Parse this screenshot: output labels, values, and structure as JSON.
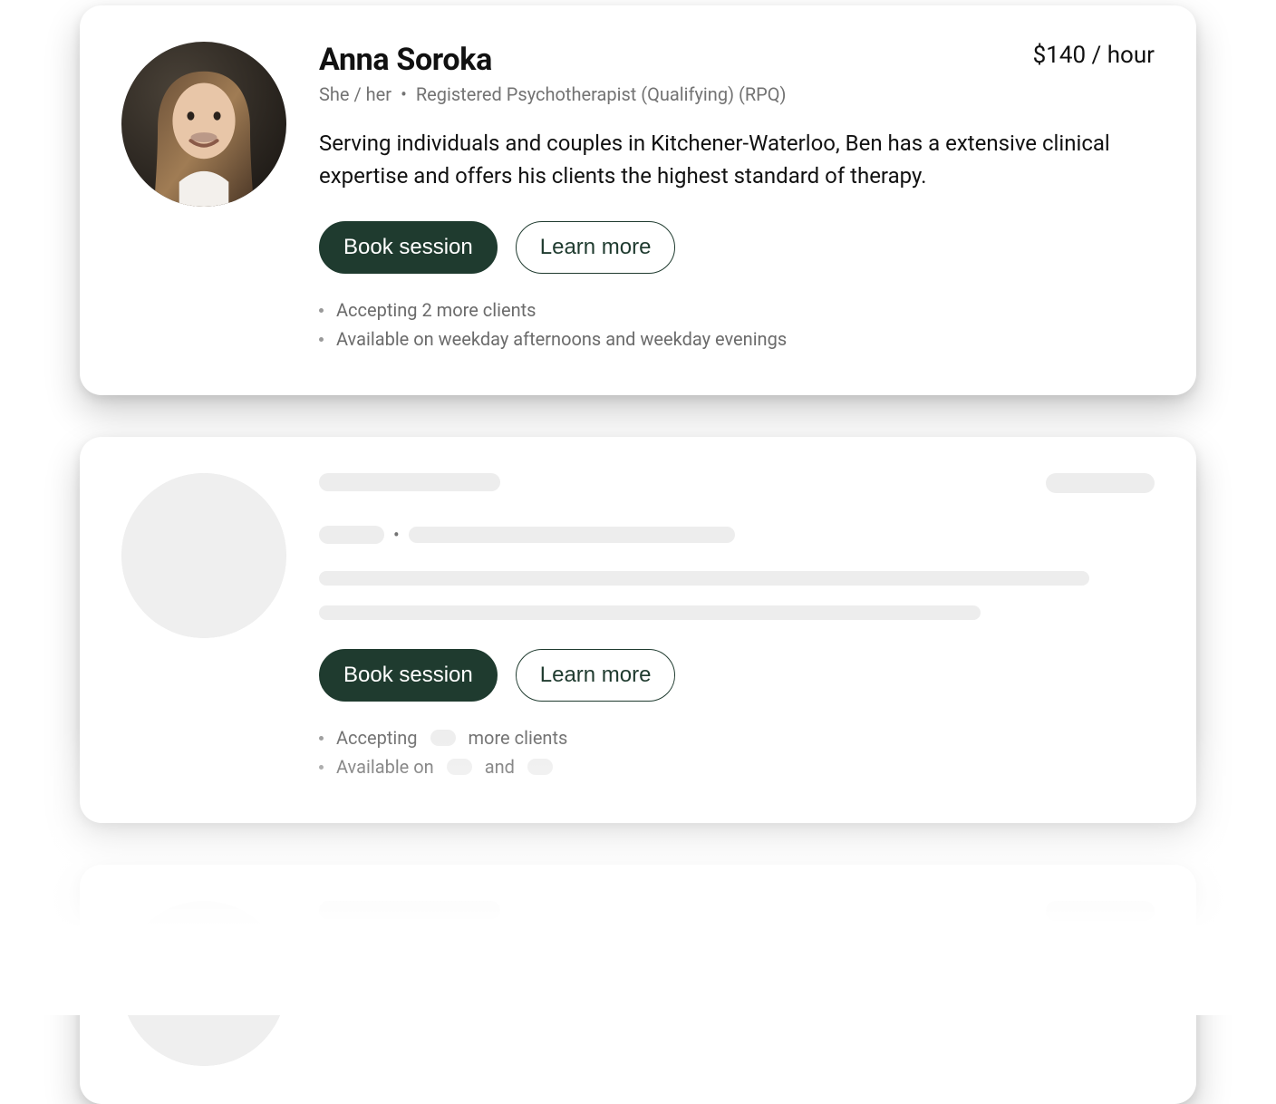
{
  "therapist": {
    "name": "Anna Soroka",
    "pronouns": "She / her",
    "credentials": "Registered Psychotherapist (Qualifying) (RPQ)",
    "price": "$140 / hour",
    "bio": "Serving individuals and couples in Kitchener-Waterloo, Ben has a extensive clinical expertise and offers his clients the highest standard of therapy.",
    "book_label": "Book session",
    "learn_label": "Learn more",
    "accepting": "Accepting 2 more clients",
    "availability": "Available on weekday afternoons and weekday evenings"
  },
  "skeleton": {
    "book_label": "Book session",
    "learn_label": "Learn more",
    "accepting_prefix": "Accepting",
    "accepting_suffix": "more clients",
    "available_prefix": "Available on",
    "available_mid": "and"
  },
  "colors": {
    "brand_dark_green": "#1f3b2f",
    "text_muted": "#737373",
    "skeleton_gray": "#ededed"
  }
}
